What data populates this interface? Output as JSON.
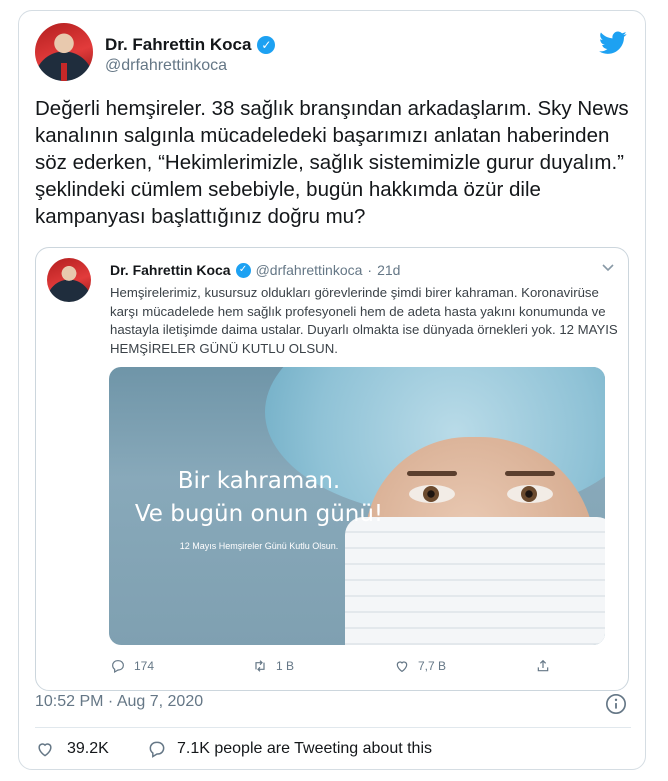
{
  "tweet": {
    "author_name": "Dr. Fahrettin Koca",
    "author_handle": "@drfahrettinkoca",
    "text": "Değerli hemşireler. 38 sağlık branşından arkadaşlarım. Sky News kanalının salgınla mücadeledeki başarımızı anlatan haberinden söz ederken, “Hekimlerimizle, sağlık sistemimizle gurur duyalım.” şeklindeki cümlem sebebiyle, bugün hakkımda özür dile kampanyası başlattığınız doğru mu?",
    "timestamp": "10:52 PM · Aug 7, 2020",
    "likes": "39.2K",
    "retweet_text": "7.1K people are Tweeting about this",
    "brand_color": "#1da1f2",
    "like_icon": "heart-outline-icon",
    "reply_icon": "speech-bubble-icon",
    "info_icon": "info-circle-icon"
  },
  "quoted": {
    "author_name": "Dr. Fahrettin Koca",
    "author_handle": "@drfahrettinkoca",
    "separator": "·",
    "age": "21d",
    "text": "Hemşirelerimiz, kusursuz oldukları görevlerinde şimdi birer kahraman. Koronavirüse karşı mücadelede hem sağlık profesyoneli hem de adeta hasta yakını konumunda ve hastayla iletişimde daima ustalar. Duyarlı olmakta ise dünyada örnekleri yok. 12 MAYIS HEMŞİRELER GÜNÜ KUTLU OLSUN.",
    "media": {
      "headline_line1": "Bir kahraman.",
      "headline_line2": "Ve bugün onun günü!",
      "small_text": "12 Mayıs Hemşireler Günü Kutlu Olsun."
    },
    "actions": {
      "replies": "174",
      "retweets": "1 B",
      "likes": "7,7 B"
    }
  }
}
